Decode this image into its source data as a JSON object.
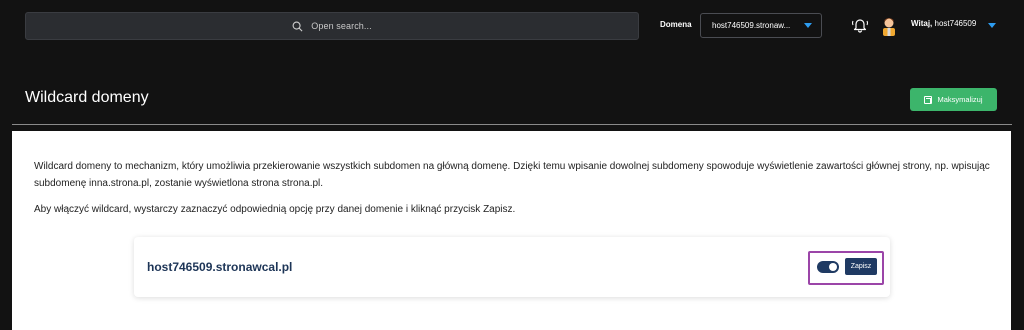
{
  "header": {
    "search_placeholder": "Open search...",
    "domain_label": "Domena",
    "domain_selected": "host746509.stronaw...",
    "greeting_prefix": "Witaj,",
    "greeting_user": "host746509"
  },
  "page": {
    "title": "Wildcard domeny",
    "maximize_label": "Maksymalizuj"
  },
  "content": {
    "description": "Wildcard domeny to mechanizm, który umożliwia przekierowanie wszystkich subdomen na główną domenę. Dzięki temu wpisanie dowolnej subdomeny spowoduje wyświetlenie zawartości głównej strony, np. wpisując subdomenę inna.strona.pl, zostanie wyświetlona strona strona.pl.",
    "hint": "Aby włączyć wildcard, wystarczy zaznaczyć odpowiednią opcję przy danej domenie i kliknąć przycisk Zapisz."
  },
  "domain_card": {
    "domain": "host746509.stronawcal.pl",
    "wildcard_enabled": true,
    "save_label": "Zapisz"
  },
  "colors": {
    "accent_blue": "#2d9cf0",
    "button_green": "#3cb56b",
    "navy": "#1f3a63",
    "highlight_purple": "#9b45a8"
  },
  "icons": [
    "search-icon",
    "chevron-down-icon",
    "bell-icon",
    "user-avatar-icon",
    "maximize-icon"
  ]
}
